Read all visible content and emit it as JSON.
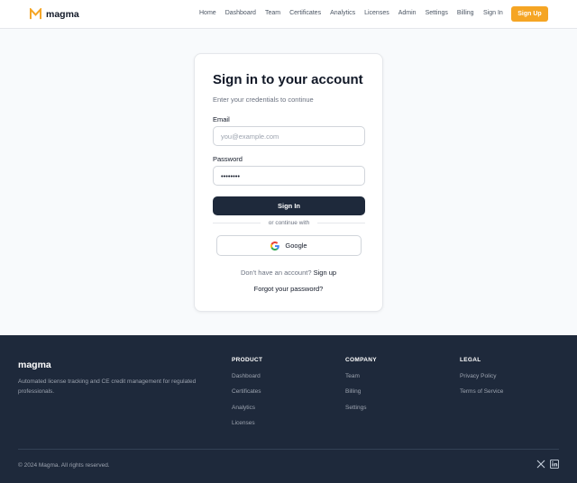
{
  "brand": {
    "name": "magma",
    "accent": "#f5a524"
  },
  "header": {
    "nav": [
      "Home",
      "Dashboard",
      "Team",
      "Certificates",
      "Analytics",
      "Licenses",
      "Admin",
      "Settings",
      "Billing"
    ],
    "signin_label": "Sign In",
    "signup_label": "Sign Up"
  },
  "card": {
    "title": "Sign in to your account",
    "subtitle": "Enter your credentials to continue",
    "email_label": "Email",
    "email_placeholder": "you@example.com",
    "password_label": "Password",
    "password_value": "••••••••",
    "submit_label": "Sign In",
    "divider_text": "or continue with",
    "google_label": "Google",
    "no_account_text": "Don't have an account?",
    "signup_link": "Sign up",
    "forgot_label": "Forgot your password?"
  },
  "footer": {
    "brand": "magma",
    "description": "Automated license tracking and CE credit management for regulated professionals.",
    "columns": [
      {
        "heading": "PRODUCT",
        "links": [
          "Dashboard",
          "Certificates",
          "Analytics",
          "Licenses"
        ]
      },
      {
        "heading": "COMPANY",
        "links": [
          "Team",
          "Billing",
          "Settings"
        ]
      },
      {
        "heading": "LEGAL",
        "links": [
          "Privacy Policy",
          "Terms of Service"
        ]
      }
    ],
    "copyright": "© 2024 Magma. All rights reserved.",
    "social_icons": [
      "x-icon",
      "linkedin-icon"
    ]
  }
}
